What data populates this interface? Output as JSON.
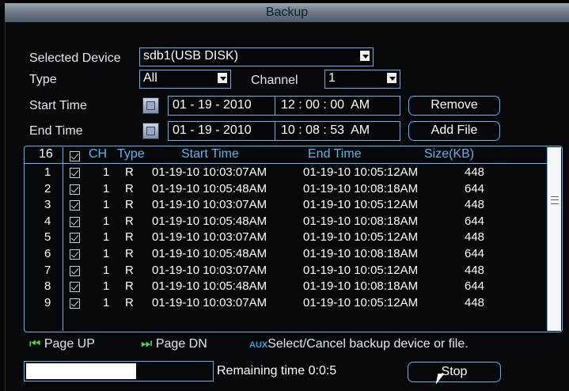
{
  "window": {
    "title": "Backup"
  },
  "form": {
    "selected_device_label": "Selected Device",
    "selected_device_value": "sdb1(USB DISK)",
    "type_label": "Type",
    "type_value": "All",
    "channel_label": "Channel",
    "channel_value": "1",
    "start_time_label": "Start Time",
    "start_date": {
      "m": "01",
      "d": "19",
      "y": "2010"
    },
    "start_clock": {
      "h": "12",
      "mi": "00",
      "s": "00",
      "ampm": "AM"
    },
    "end_time_label": "End Time",
    "end_date": {
      "m": "01",
      "d": "19",
      "y": "2010"
    },
    "end_clock": {
      "h": "10",
      "mi": "08",
      "s": "53",
      "ampm": "AM"
    },
    "remove_button": "Remove",
    "add_file_button": "Add File"
  },
  "table": {
    "headers": {
      "count": "16",
      "ch": "CH",
      "type": "Type",
      "start": "Start Time",
      "end": "End Time",
      "size": "Size(KB)"
    },
    "rows": [
      {
        "idx": "1",
        "ch": "1",
        "type": "R",
        "start": "01-19-10 10:03:07AM",
        "end": "01-19-10 10:05:12AM",
        "size": "448",
        "checked": true
      },
      {
        "idx": "2",
        "ch": "1",
        "type": "R",
        "start": "01-19-10 10:05:48AM",
        "end": "01-19-10 10:08:18AM",
        "size": "644",
        "checked": true
      },
      {
        "idx": "3",
        "ch": "1",
        "type": "R",
        "start": "01-19-10 10:03:07AM",
        "end": "01-19-10 10:05:12AM",
        "size": "448",
        "checked": true
      },
      {
        "idx": "4",
        "ch": "1",
        "type": "R",
        "start": "01-19-10 10:05:48AM",
        "end": "01-19-10 10:08:18AM",
        "size": "644",
        "checked": true
      },
      {
        "idx": "5",
        "ch": "1",
        "type": "R",
        "start": "01-19-10 10:03:07AM",
        "end": "01-19-10 10:05:12AM",
        "size": "448",
        "checked": true
      },
      {
        "idx": "6",
        "ch": "1",
        "type": "R",
        "start": "01-19-10 10:05:48AM",
        "end": "01-19-10 10:08:18AM",
        "size": "644",
        "checked": true
      },
      {
        "idx": "7",
        "ch": "1",
        "type": "R",
        "start": "01-19-10 10:03:07AM",
        "end": "01-19-10 10:05:12AM",
        "size": "448",
        "checked": true
      },
      {
        "idx": "8",
        "ch": "1",
        "type": "R",
        "start": "01-19-10 10:05:48AM",
        "end": "01-19-10 10:08:18AM",
        "size": "644",
        "checked": true
      },
      {
        "idx": "9",
        "ch": "1",
        "type": "R",
        "start": "01-19-10 10:03:07AM",
        "end": "01-19-10 10:05:12AM",
        "size": "448",
        "checked": true
      }
    ]
  },
  "footer": {
    "page_up": "Page UP",
    "page_dn": "Page DN",
    "aux_label": "AUX",
    "hint": "Select/Cancel backup device or file.",
    "remaining_time": "Remaining time 0:0:5",
    "stop_button": "Stop",
    "progress": 0.6
  },
  "colors": {
    "accent": "#5fb4ea",
    "nav_icon": "#4fd04f",
    "aux": "#3aa2e0"
  }
}
